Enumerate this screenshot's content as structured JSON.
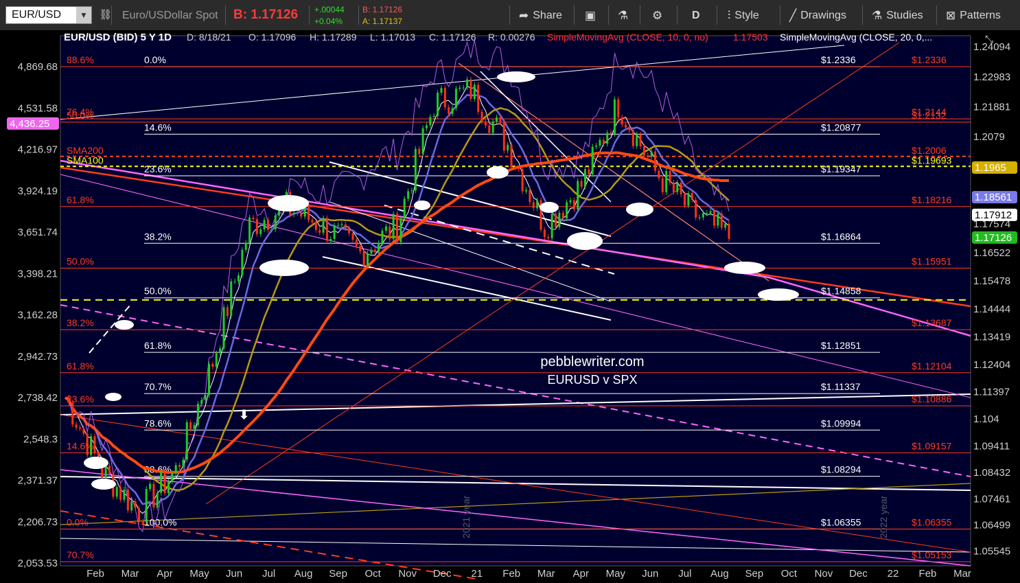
{
  "toolbar": {
    "symbol": "EUR/USD",
    "description": "Euro/USDollar Spot",
    "bid_label": "B: 1.17126",
    "change_abs": "+.00044",
    "change_pct": "+0.04%",
    "bid_small": "B: 1.17126",
    "ask_small": "A: 1.17137",
    "buttons": [
      {
        "label": "Share",
        "icon": "share-icon"
      },
      {
        "label": "",
        "icon": "gallery-icon"
      },
      {
        "label": "",
        "icon": "flask-icon"
      },
      {
        "label": "",
        "icon": "gear-icon"
      },
      {
        "label": "D",
        "icon": ""
      },
      {
        "label": "Style",
        "icon": "candles-icon"
      },
      {
        "label": "Drawings",
        "icon": "pencil-icon"
      },
      {
        "label": "Studies",
        "icon": "flask-icon"
      },
      {
        "label": "Patterns",
        "icon": "patterns-icon"
      }
    ]
  },
  "header": {
    "title": "EUR/USD (BID) 5 Y 1D",
    "date": "D: 8/18/21",
    "open": "O: 1.17096",
    "high": "H: 1.17289",
    "low": "L: 1.17013",
    "close": "C: 1.17126",
    "range": "R: 0.00276",
    "sma10": "SimpleMovingAvg (CLOSE, 10, 0, no)",
    "sma10_value": "1.17503",
    "sma20": "SimpleMovingAvg (CLOSE, 20, 0,..."
  },
  "watermark": {
    "line1": "pebblewriter.com",
    "line2": "EURUSD  v  SPX"
  },
  "chart_data": {
    "type": "line",
    "title": "EUR/USD (BID) 5 Y 1D",
    "x_ticks": [
      "Feb",
      "Mar",
      "Apr",
      "May",
      "Jun",
      "Jul",
      "Aug",
      "Sep",
      "Oct",
      "Nov",
      "Dec",
      "21",
      "Feb",
      "Mar",
      "Apr",
      "May",
      "Jun",
      "Jul",
      "Aug",
      "Sep",
      "Oct",
      "Nov",
      "Dec",
      "22",
      "Feb",
      "Mar"
    ],
    "right_axis_ticks": [
      "1.24094",
      "1.22983",
      "1.21881",
      "1.2079",
      "1.19703",
      "1.18627",
      "1.17574",
      "1.16522",
      "1.15478",
      "1.14444",
      "1.13419",
      "1.12404",
      "1.11397",
      "1.104",
      "1.09411",
      "1.08432",
      "1.07461",
      "1.06499",
      "1.05545"
    ],
    "left_axis_ticks": [
      "4,869.68",
      "4,531.58",
      "4,216.97",
      "3,924.19",
      "3,651.74",
      "3,398.21",
      "3,162.28",
      "2,942.73",
      "2,738.42",
      "2,548.3",
      "2,371.37",
      "2,206.73",
      "2,053.53"
    ],
    "ylim_right": [
      1.05,
      1.245
    ],
    "price_badges": [
      {
        "label": "1.1965",
        "value": 1.1965,
        "color": "#d4b000"
      },
      {
        "label": "1.18561",
        "value": 1.18561,
        "color": "#7a7ae8"
      },
      {
        "label": "1.17912",
        "value": 1.17912,
        "color": "#ffffff"
      },
      {
        "label": "1.17126",
        "value": 1.17126,
        "color": "#22bb22"
      }
    ],
    "left_badge": {
      "label": "4,436.25",
      "color": "#ee66ee"
    },
    "fib_white": [
      {
        "pct": "0.0%",
        "value": 1.2336,
        "label": "$1.2336"
      },
      {
        "pct": "14.6%",
        "value": 1.20877,
        "label": "$1.20877"
      },
      {
        "pct": "23.6%",
        "value": 1.19347,
        "label": "$1.19347"
      },
      {
        "pct": "38.2%",
        "value": 1.16864,
        "label": "$1.16864"
      },
      {
        "pct": "50.0%",
        "value": 1.14858,
        "label": "$1.14858"
      },
      {
        "pct": "61.8%",
        "value": 1.12851,
        "label": "$1.12851"
      },
      {
        "pct": "70.7%",
        "value": 1.11337,
        "label": "$1.11337"
      },
      {
        "pct": "78.6%",
        "value": 1.09994,
        "label": "$1.09994"
      },
      {
        "pct": "88.6%",
        "value": 1.08294,
        "label": "$1.08294"
      },
      {
        "pct": "100.0%",
        "value": 1.06355,
        "label": "$1.06355"
      }
    ],
    "fib_red": [
      {
        "pct": "88.6%",
        "value": 1.2336,
        "label": "$1.2336"
      },
      {
        "pct": "76.4%",
        "value": 1.2144,
        "label": "$1.2144"
      },
      {
        "pct": "50.0%",
        "value": 1.2132,
        "label": "$1.2132"
      },
      {
        "pct": "61.8%",
        "value": 1.18216,
        "label": "$1.18216"
      },
      {
        "pct": "50.0%",
        "value": 1.15951,
        "label": "$1.15951"
      },
      {
        "pct": "38.2%",
        "value": 1.13687,
        "label": "$1.13687"
      },
      {
        "pct": "61.8%",
        "value": 1.12104,
        "label": "$1.12104"
      },
      {
        "pct": "23.6%",
        "value": 1.10886,
        "label": "$1.10886"
      },
      {
        "pct": "14.6%",
        "value": 1.09157,
        "label": "$1.09157"
      },
      {
        "pct": "0.0%",
        "value": 1.06355,
        "label": "$1.06355"
      },
      {
        "pct": "70.7%",
        "value": 1.05153,
        "label": "$1.05153"
      }
    ],
    "sma_labels": [
      {
        "label": "SMA200",
        "value": 1.2006,
        "right": "$1.2006"
      },
      {
        "label": "SMA100",
        "value": 1.19693,
        "right": "$1.19693"
      }
    ],
    "year_labels": [
      "2021 year",
      "2022 year"
    ],
    "colors": {
      "bg": "#00002e",
      "fib_white": "#ffffff",
      "fib_red": "#ff3d1a",
      "sma200": "#ff4a10",
      "sma100": "#b89a10",
      "sma20": "#6a6ae0",
      "sma10": "#ffffff",
      "spx": "#b060e0",
      "price_up": "#22cc22",
      "price_down": "#ff3311",
      "trend_magenta": "#ff66ff",
      "dashed_yellow": "#ffff00"
    }
  }
}
